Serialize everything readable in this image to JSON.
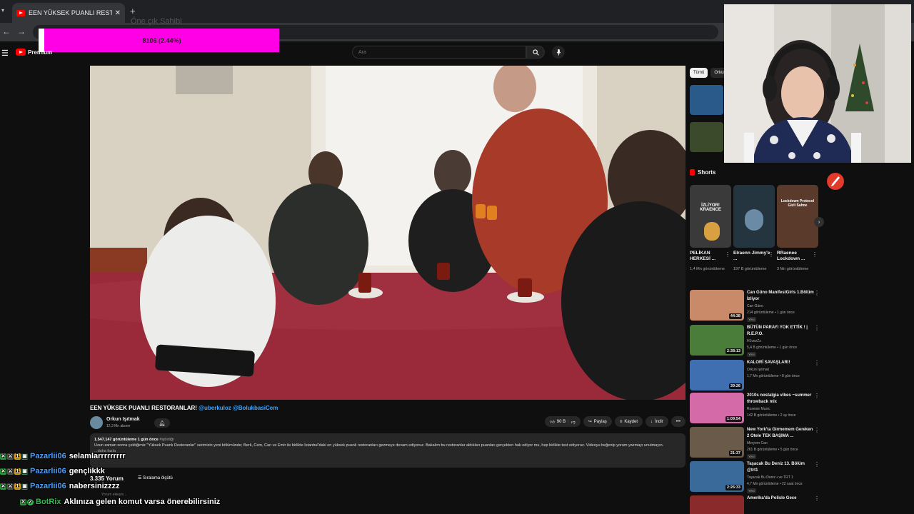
{
  "browser": {
    "tab_title": "EEN YÜKSEK PUANLI RESTORANLAR!",
    "tab_close": "✕",
    "new_tab": "+",
    "ghost_text": "Öne çık Sahibi"
  },
  "overlay": {
    "progress_text": "8106 (2.44%)"
  },
  "youtube": {
    "logo_label": "Premium",
    "search_placeholder": "Ara"
  },
  "video": {
    "title_main": "EEN YÜKSEK PUANLI RESTORANLAR!",
    "title_tags": " @uberkuloz @BolukbasiCem",
    "channel_name": "Orkun Işıtmak",
    "channel_subs": "12,3 Mn abone",
    "likes": "90 B",
    "share_label": "Paylaş",
    "save_label": "Kaydet",
    "download_label": "İndir",
    "more_label": "•••"
  },
  "description": {
    "stats": "1.547.147 görüntüleme  1 gün önce",
    "hashtag": " #işbirliği",
    "text": "Uzun zaman sonra çektiğimiz \"Yüksek Puanlı Restoranlar\" serimizin yeni bölümünde; Berk, Cem, Can ve Emir ile birlikte İstanbul'daki en yüksek puanlı restoranları gezmeye devam ediyoruz. Bakalım bu restoranlar aldıkları puanları gerçekten hak ediyor mu, hep birlikte test ediyoruz. Videoyu beğenip yorum yazmayı unutmayın.",
    "more": "...daha fazla"
  },
  "comments": {
    "count": "3.335 Yorum",
    "sort_label": "Sıralama ölçütü",
    "add_placeholder": "Yorum ekleyin..."
  },
  "chat": [
    {
      "user": "Pazarlii06",
      "message": "selamlarrrrrrrrr"
    },
    {
      "user": "Pazarlii06",
      "message": "gençlikkk"
    },
    {
      "user": "Pazarlii06",
      "message": "nabersinizzzz"
    },
    {
      "user": "BotRix",
      "message": "Aklınıza gelen komut varsa önerebilirsiniz"
    }
  ],
  "sidebar": {
    "chips": [
      "Tümü",
      "Orkun"
    ],
    "shorts_title": "Shorts",
    "shorts": [
      {
        "title": "PELİKAN HERKESİ ...",
        "views": "1,4 Mn görüntüleme",
        "overlay": "İZLİYOR! KRAENCE"
      },
      {
        "title": "Elraenn Jimmy'e ...",
        "views": "197 B görüntüleme",
        "overlay": ""
      },
      {
        "title": "RRaenee Lockdown ...",
        "views": "3 Mn görüntüleme",
        "overlay": "Lockdown Protocol Gizli Sahne"
      }
    ],
    "recommendations": [
      {
        "title": "Can Güno ManifestGirls 1.Bölüm İzliyor",
        "channel": "Can Güno",
        "meta": "214 görüntüleme • 1 gün önce",
        "duration": "44:38",
        "new": "Yeni",
        "color": "#c98a6a"
      },
      {
        "title": "BÜTÜN PARAYI YOK ETTİK ! | R.E.P.O.",
        "channel": "H1vezZz",
        "meta": "5,4 B görüntüleme • 1 gün önce",
        "duration": "2:38:13",
        "new": "Yeni",
        "color": "#4a7d3a"
      },
      {
        "title": "KALORİ SAVAŞLARI!",
        "channel": "Orkun Işıtmak",
        "meta": "1,7 Mn görüntüleme • 8 gün önce",
        "duration": "39:26",
        "new": "",
        "color": "#3f6fb0"
      },
      {
        "title": "2010s nostalgia vibes ~summer throwback mix",
        "channel": "Rosesie Music",
        "meta": "142 B görüntüleme • 2 ay önce",
        "duration": "1:09:54",
        "new": "",
        "color": "#d46aa8"
      },
      {
        "title": "New York'ta Girmemem Gereken 2 Otele TEK BAŞIMA ...",
        "channel": "Meryem Can",
        "meta": "261 B görüntüleme • 5 gün önce",
        "duration": "21:37",
        "new": "Yeni",
        "color": "#6a5a4a"
      },
      {
        "title": "Taşacak Bu Deniz 13. Bölüm @trt1",
        "channel": "Taşacak Bu Deniz • ve TRT 1",
        "meta": "4,7 Mn görüntüleme • 22 saat önce",
        "duration": "2:26:33",
        "new": "Yeni",
        "color": "#3a6a9a"
      },
      {
        "title": "Amerika'da Polisle Gece",
        "channel": "",
        "meta": "",
        "duration": "",
        "new": "",
        "color": "#8a2a2a"
      }
    ]
  }
}
